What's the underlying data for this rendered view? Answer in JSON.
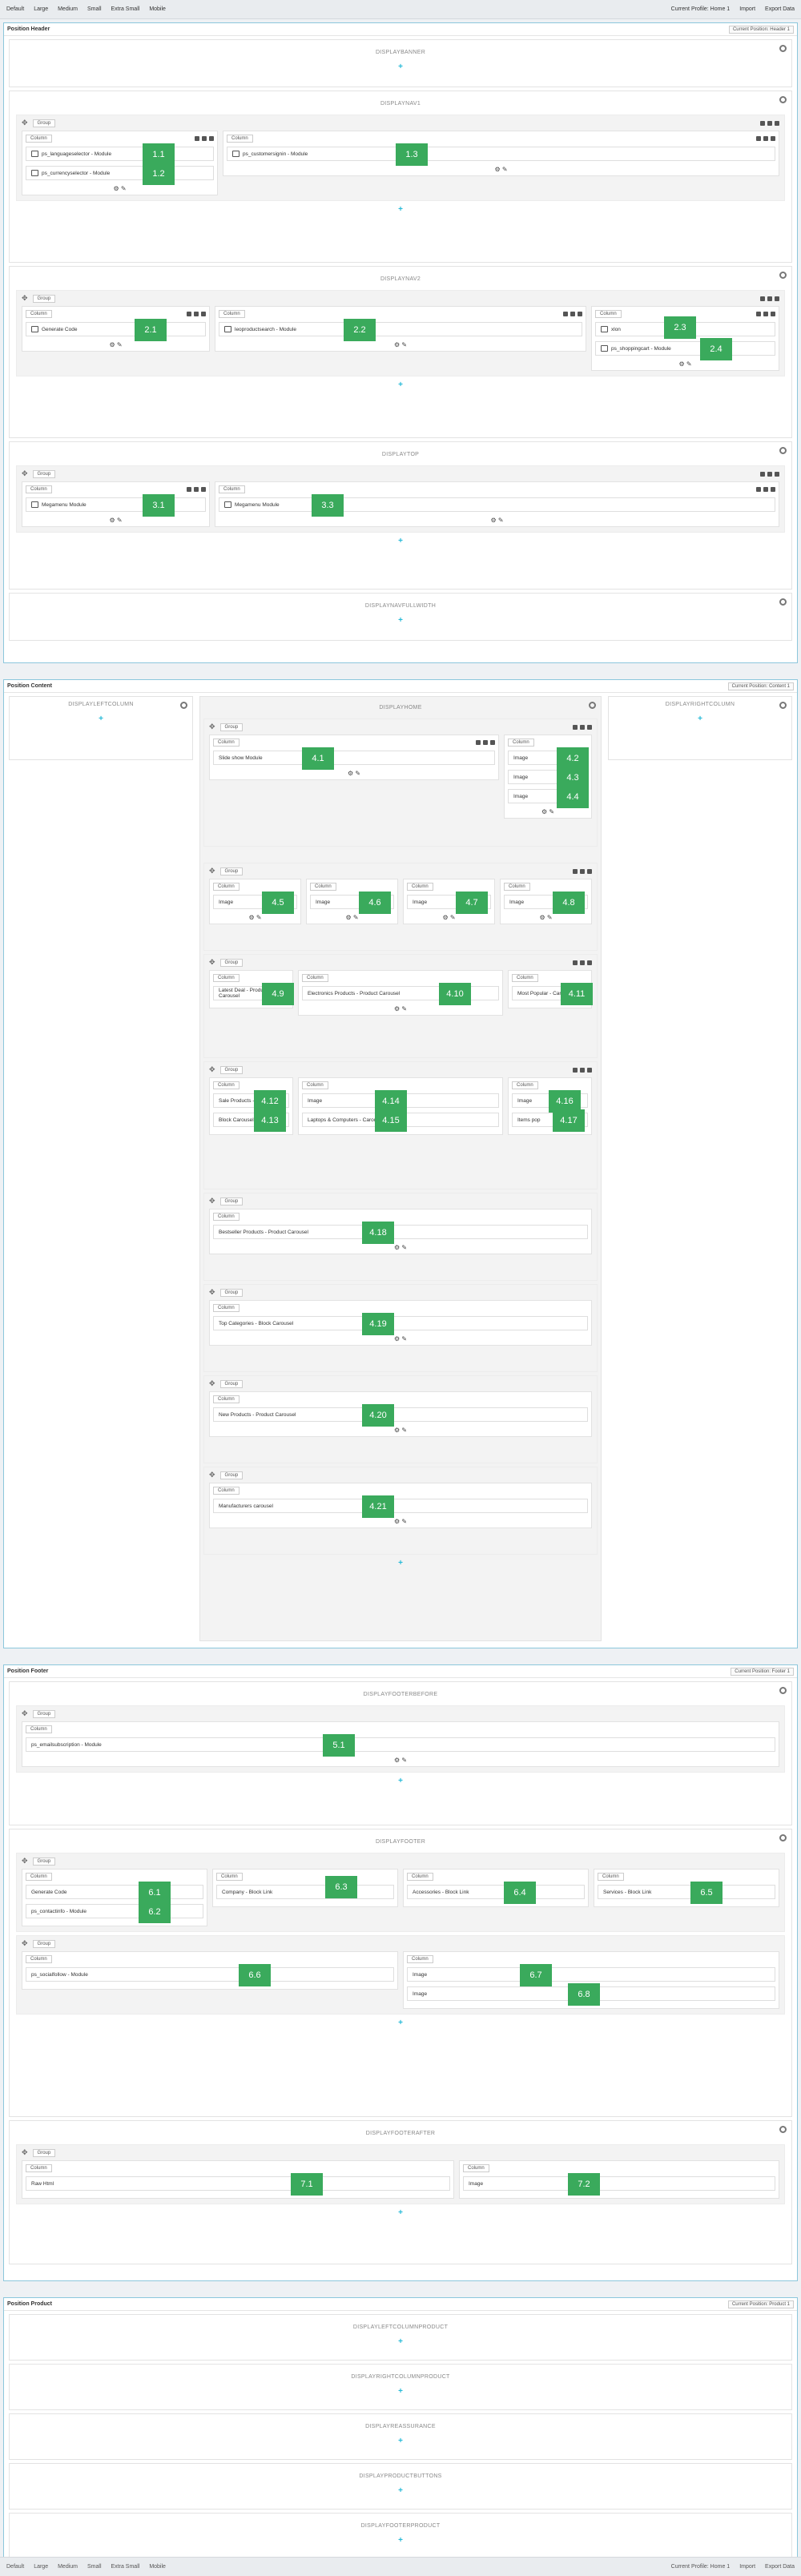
{
  "devices": [
    "Default",
    "Large",
    "Medium",
    "Small",
    "Extra Small",
    "Mobile"
  ],
  "top_right": [
    "Current Profile: Home 1",
    "Import",
    "Export Data"
  ],
  "positions": [
    {
      "title": "Position Header",
      "profile": "Current Position: Header 1",
      "hooks": [
        "DISPLAYBANNER",
        "DISPLAYNAV1",
        "DISPLAYNAV2",
        "DISPLAYTOP",
        "DISPLAYNAVFULLWIDTH"
      ]
    },
    {
      "title": "Position Content",
      "profile": "Current Position: Content 1",
      "hooks": [
        "DISPLAYLEFTCOLUMN",
        "DISPLAYHOME",
        "DISPLAYRIGHTCOLUMN"
      ]
    },
    {
      "title": "Position Footer",
      "profile": "Current Position: Footer 1",
      "hooks": [
        "DISPLAYFOOTERBEFORE",
        "DISPLAYFOOTER",
        "DISPLAYFOOTERAFTER"
      ]
    },
    {
      "title": "Position Product",
      "profile": "Current Position: Product 1",
      "hooks": [
        "DISPLAYLEFTCOLUMNPRODUCT",
        "DISPLAYRIGHTCOLUMNPRODUCT",
        "DISPLAYREASSURANCE",
        "DISPLAYPRODUCTBUTTONS",
        "DISPLAYFOOTERPRODUCT"
      ]
    }
  ],
  "labels": {
    "group": "Group",
    "column": "Column",
    "plus": "+"
  },
  "modules": {
    "nav1": [
      "ps_languageselector - Module",
      "ps_currencyselector - Module",
      "ps_customersignin - Module"
    ],
    "nav2": [
      "Generate Code",
      "leoproductsearch - Module",
      "xlon",
      "ps_shoppingcart - Module"
    ],
    "top": [
      "Megamenu Module",
      "Megamenu Module"
    ],
    "home1": [
      "Slide show Module",
      "Image",
      "Image",
      "Image"
    ],
    "home2": [
      "Image",
      "Image",
      "Image",
      "Image"
    ],
    "home3": [
      "Latest Deal - Product Carousel",
      "Electronics Products - Product Carousel",
      "Most Popular - Carousel"
    ],
    "home4": [
      "Sale Products - Carousel",
      "Block Carousel",
      "Image",
      "Laptops & Computers - Carousel",
      "Image",
      "Items pop"
    ],
    "home5": [
      "Bestseller Products - Product Carousel"
    ],
    "home6": [
      "Top Categories - Block Carousel"
    ],
    "home7": [
      "New Products - Product Carousel"
    ],
    "home8": [
      "Manufacturers carousel"
    ],
    "fb": [
      "ps_emailsubscription - Module"
    ],
    "f1": [
      "Generate Code",
      "ps_contactinfo - Module",
      "Company - Block Link",
      "Accessories - Block Link",
      "Services - Block Link"
    ],
    "f2": [
      "ps_socialfollow - Module",
      "Image",
      "Image"
    ],
    "fa": [
      "Raw Html",
      "Image"
    ]
  },
  "badges": [
    "1.1",
    "1.2",
    "1.3",
    "2.1",
    "2.2",
    "2.3",
    "2.4",
    "3.1",
    "3.3",
    "4.1",
    "4.2",
    "4.3",
    "4.4",
    "4.5",
    "4.6",
    "4.7",
    "4.8",
    "4.9",
    "4.10",
    "4.11",
    "4.12",
    "4.13",
    "4.14",
    "4.15",
    "4.16",
    "4.17",
    "4.18",
    "4.19",
    "4.20",
    "4.21",
    "5.1",
    "6.1",
    "6.2",
    "6.3",
    "6.4",
    "6.5",
    "6.6",
    "6.7",
    "6.8",
    "7.1",
    "7.2"
  ]
}
